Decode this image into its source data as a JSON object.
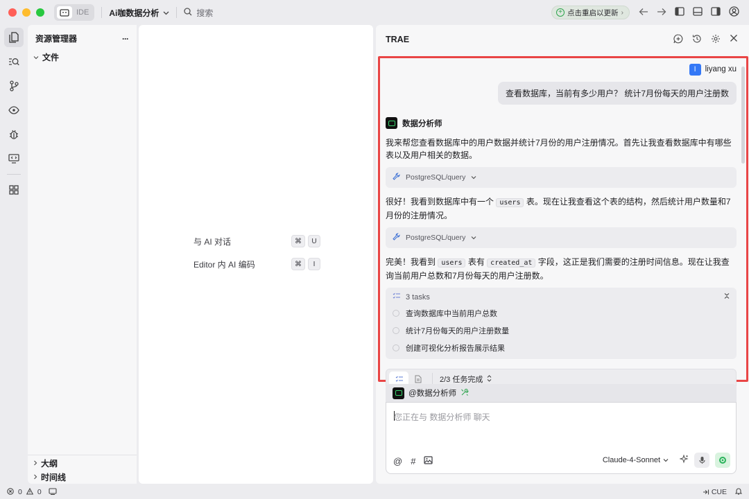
{
  "titlebar": {
    "ide_label": "IDE",
    "project_name": "Ai咖数据分析",
    "search_label": "搜索",
    "update_label": "点击重启以更新"
  },
  "explorer": {
    "title": "资源管理器",
    "more": "···",
    "folder": "文件",
    "outline": "大纲",
    "timeline": "时间线"
  },
  "editor": {
    "shortcuts": [
      {
        "label": "与 AI 对话",
        "keys": [
          "⌘",
          "U"
        ]
      },
      {
        "label": "Editor 内 AI 编码",
        "keys": [
          "⌘",
          "I"
        ]
      }
    ]
  },
  "chat": {
    "title": "TRAE",
    "user_initial": "l",
    "user_name": "liyang xu",
    "user_message": "查看数据库，当前有多少用户？ 统计7月份每天的用户注册数",
    "agent_name": "数据分析师",
    "para1": "我来帮您查看数据库中的用户数据并统计7月份的用户注册情况。首先让我查看数据库中有哪些表以及用户相关的数据。",
    "tool1": "PostgreSQL/query",
    "para2_a": "很好！我看到数据库中有一个",
    "para2_code": "users",
    "para2_b": "表。现在让我查看这个表的结构，然后统计用户数量和7月份的注册情况。",
    "tool2": "PostgreSQL/query",
    "para3_a": "完美！我看到",
    "para3_code1": "users",
    "para3_b": "表有",
    "para3_code2": "created_at",
    "para3_c": "字段，这正是我们需要的注册时间信息。现在让我查询当前用户总数和7月份每天的用户注册数。",
    "tasks_title": "3 tasks",
    "tasks": [
      "查询数据库中当前用户总数",
      "统计7月份每天的用户注册数量",
      "创建可视化分析报告展示结果"
    ],
    "progress_text": "2/3 任务完成",
    "mention": "@数据分析师",
    "input_placeholder": "您正在与 数据分析师 聊天",
    "model": "Claude-4-Sonnet"
  },
  "statusbar": {
    "errors": "0",
    "warnings": "0",
    "cue": "CUE"
  },
  "colors": {
    "highlight": "#e94545",
    "accent_green": "#29b35a",
    "user_avatar": "#3478f6"
  }
}
